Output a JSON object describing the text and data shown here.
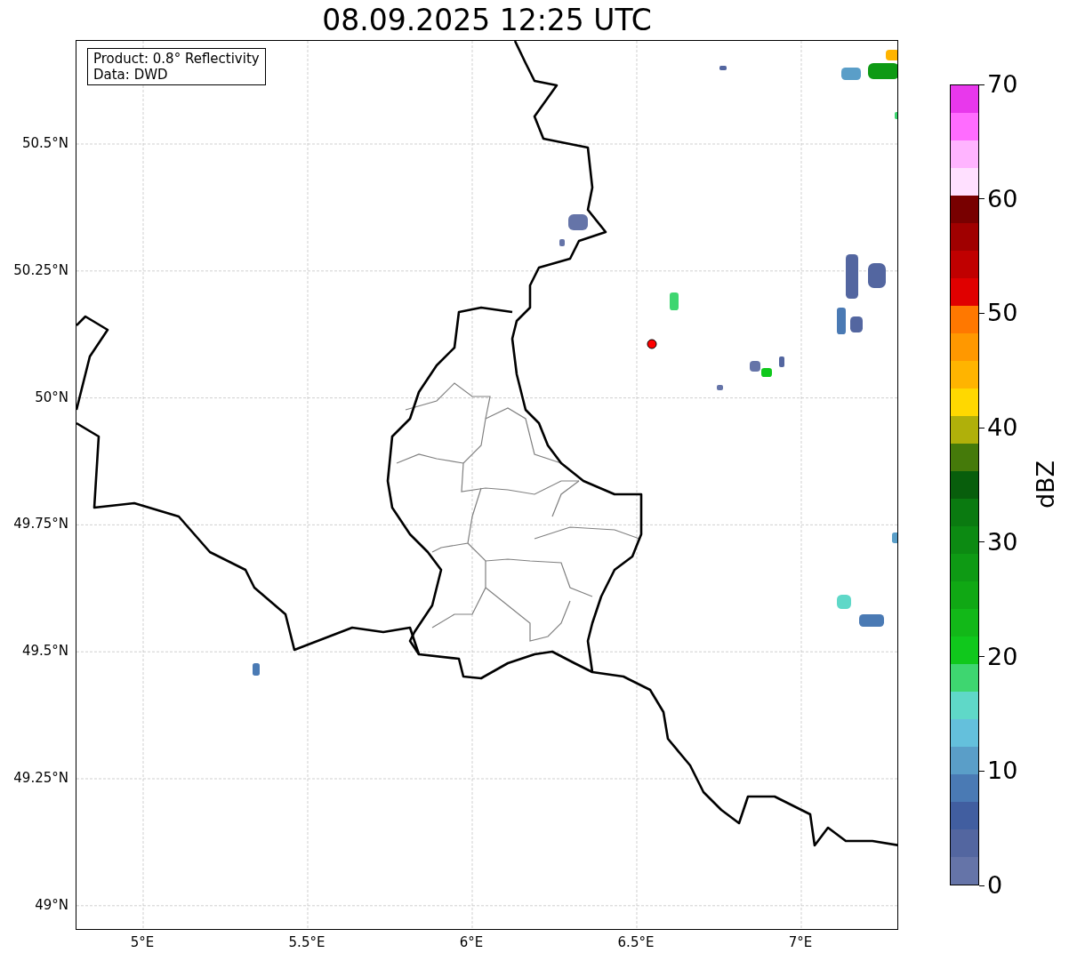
{
  "title": "08.09.2025 12:25 UTC",
  "map": {
    "info_box": [
      "Product: 0.8° Reflectivity",
      "Data: DWD"
    ],
    "x_ticks": [
      "5°E",
      "5.5°E",
      "6°E",
      "6.5°E",
      "7°E"
    ],
    "y_ticks": [
      "50.5°N",
      "50.25°N",
      "50°N",
      "49.75°N",
      "49.5°N",
      "49.25°N",
      "49°N"
    ]
  },
  "colorbar": {
    "label": "dBZ",
    "ticks": [
      "70",
      "60",
      "50",
      "40",
      "30",
      "20",
      "10",
      "0"
    ],
    "bands": [
      {
        "color": "#e838ec"
      },
      {
        "color": "#ff6cff"
      },
      {
        "color": "#ffb4ff"
      },
      {
        "color": "#ffe0ff"
      },
      {
        "color": "#780000"
      },
      {
        "color": "#a00000"
      },
      {
        "color": "#c00000"
      },
      {
        "color": "#e00000"
      },
      {
        "color": "#ff7800"
      },
      {
        "color": "#ff9800"
      },
      {
        "color": "#ffb400"
      },
      {
        "color": "#ffd800"
      },
      {
        "color": "#b0b00a"
      },
      {
        "color": "#457a0a"
      },
      {
        "color": "#085e0c"
      },
      {
        "color": "#0a7a10"
      },
      {
        "color": "#0c8a12"
      },
      {
        "color": "#0e9a14"
      },
      {
        "color": "#10a814"
      },
      {
        "color": "#12b818"
      },
      {
        "color": "#10c81c"
      },
      {
        "color": "#3ed670"
      },
      {
        "color": "#5fd8c8"
      },
      {
        "color": "#64c0dc"
      },
      {
        "color": "#5a9ec8"
      },
      {
        "color": "#4a7ab4"
      },
      {
        "color": "#415ea0"
      },
      {
        "color": "#5366a0"
      },
      {
        "color": "#6574a8"
      }
    ]
  }
}
